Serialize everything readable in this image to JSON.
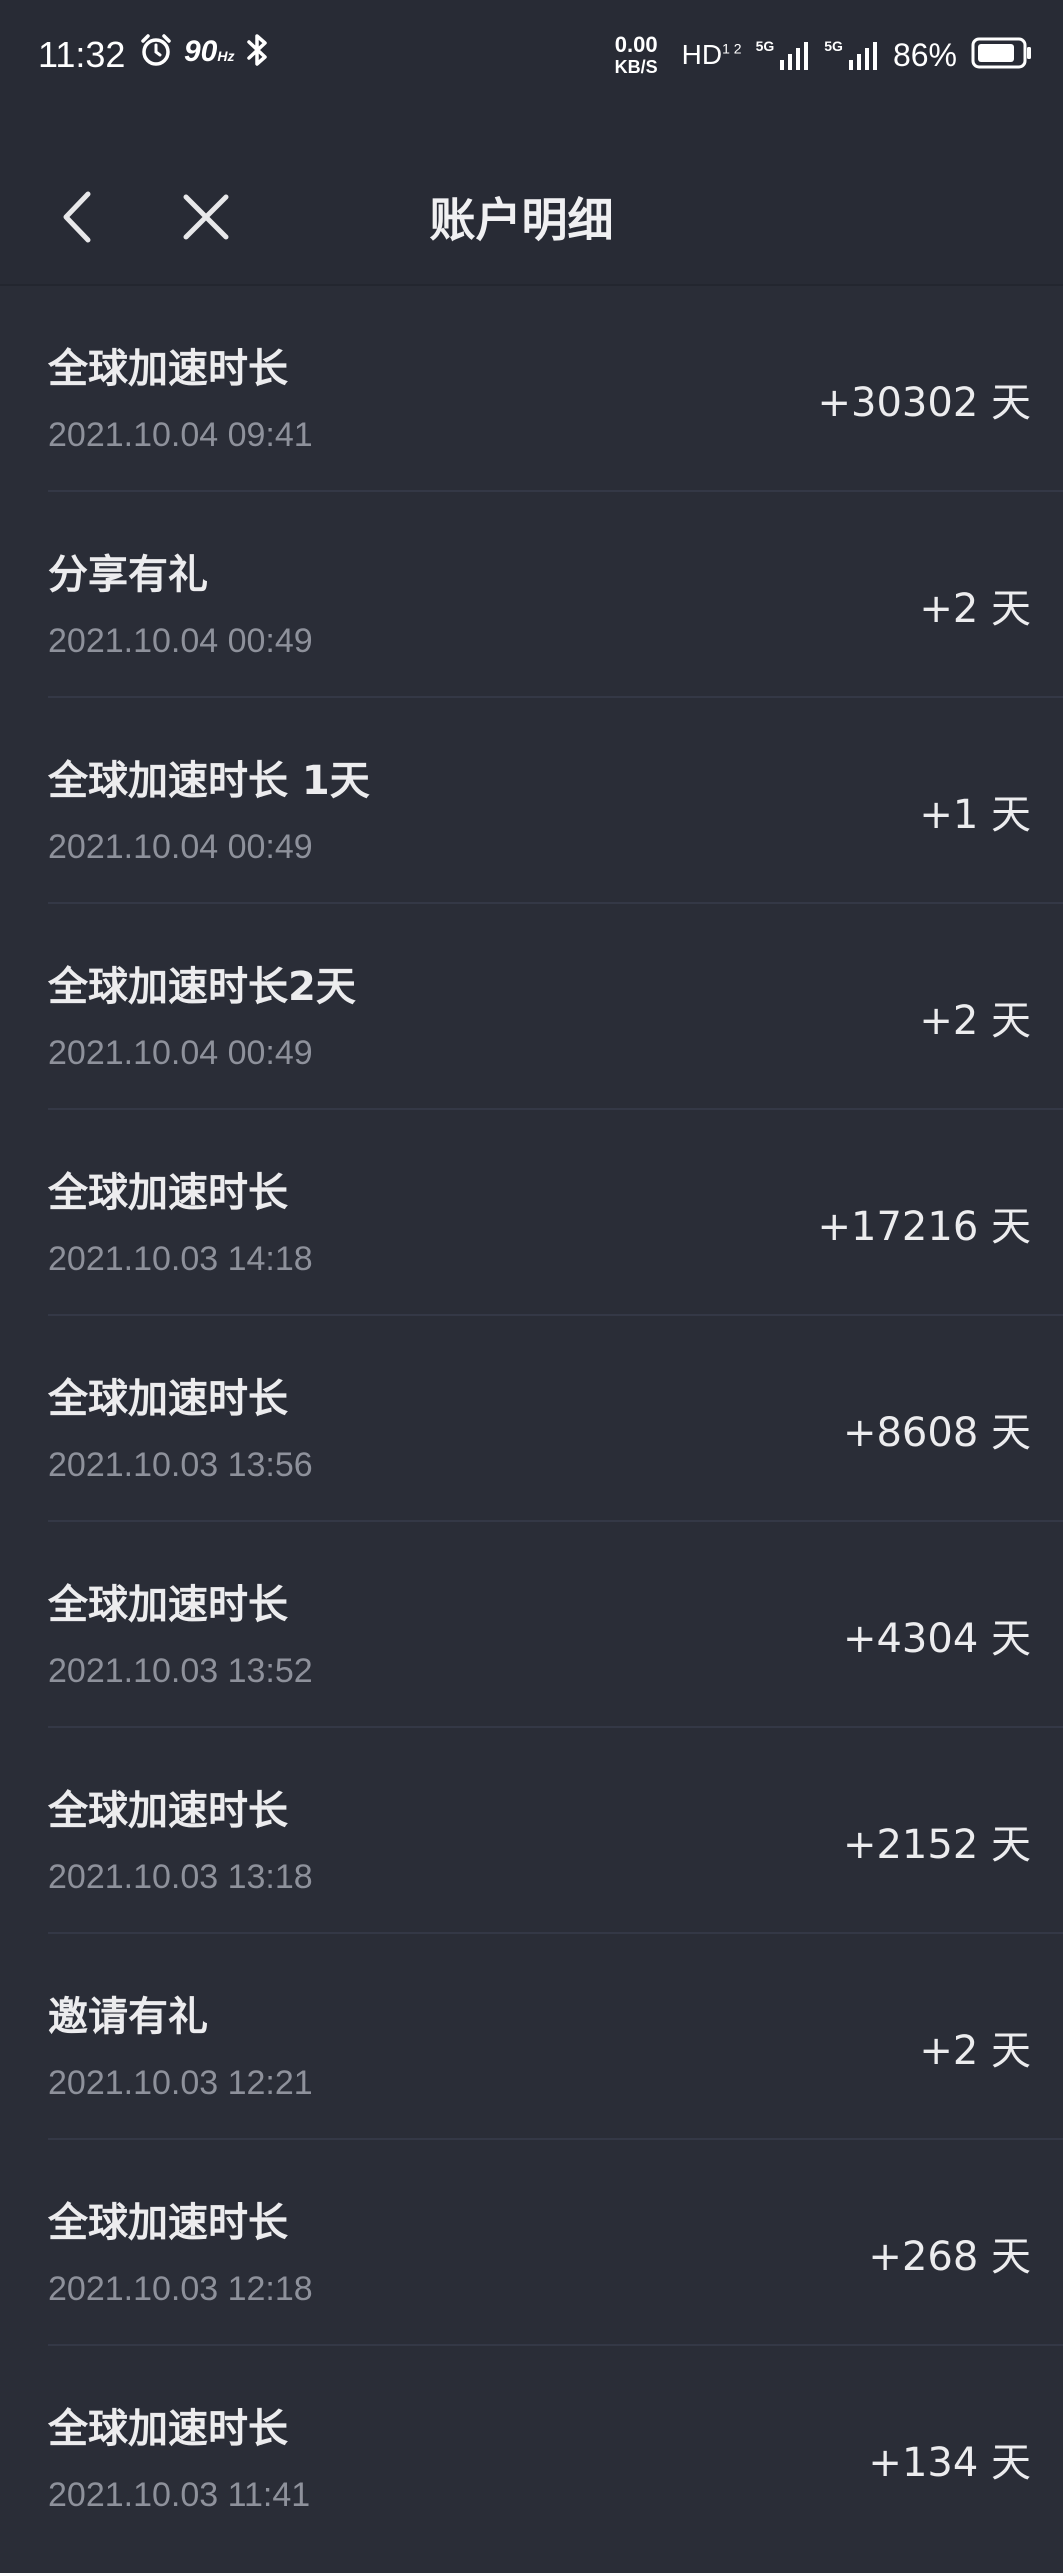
{
  "status_bar": {
    "time": "11:32",
    "refresh_rate": "90",
    "refresh_unit": "Hz",
    "net_speed_value": "0.00",
    "net_speed_unit": "KB/S",
    "hd_label": "HD",
    "hd_sub": "1 2",
    "network_1": "5G",
    "network_2": "5G",
    "battery_percent": "86%",
    "battery_level": 0.86
  },
  "header": {
    "title": "账户明细",
    "back_icon": "chevron-left-icon",
    "close_icon": "close-icon"
  },
  "records": [
    {
      "title": "全球加速时长",
      "date": "2021.10.04 09:41",
      "amount": "+30302 天"
    },
    {
      "title": "分享有礼",
      "date": "2021.10.04 00:49",
      "amount": "+2 天"
    },
    {
      "title": "全球加速时长 1天",
      "date": "2021.10.04 00:49",
      "amount": "+1 天"
    },
    {
      "title": "全球加速时长2天",
      "date": "2021.10.04 00:49",
      "amount": "+2 天"
    },
    {
      "title": "全球加速时长",
      "date": "2021.10.03 14:18",
      "amount": "+17216 天"
    },
    {
      "title": "全球加速时长",
      "date": "2021.10.03 13:56",
      "amount": "+8608 天"
    },
    {
      "title": "全球加速时长",
      "date": "2021.10.03 13:52",
      "amount": "+4304 天"
    },
    {
      "title": "全球加速时长",
      "date": "2021.10.03 13:18",
      "amount": "+2152 天"
    },
    {
      "title": "邀请有礼",
      "date": "2021.10.03 12:21",
      "amount": "+2 天"
    },
    {
      "title": "全球加速时长",
      "date": "2021.10.03 12:18",
      "amount": "+268 天"
    },
    {
      "title": "全球加速时长",
      "date": "2021.10.03 11:41",
      "amount": "+134 天"
    }
  ],
  "colors": {
    "background": "#2a2d37",
    "header_background": "#282b35",
    "divider": "#343846",
    "primary_text": "#ececee",
    "secondary_text": "#8e919b"
  }
}
